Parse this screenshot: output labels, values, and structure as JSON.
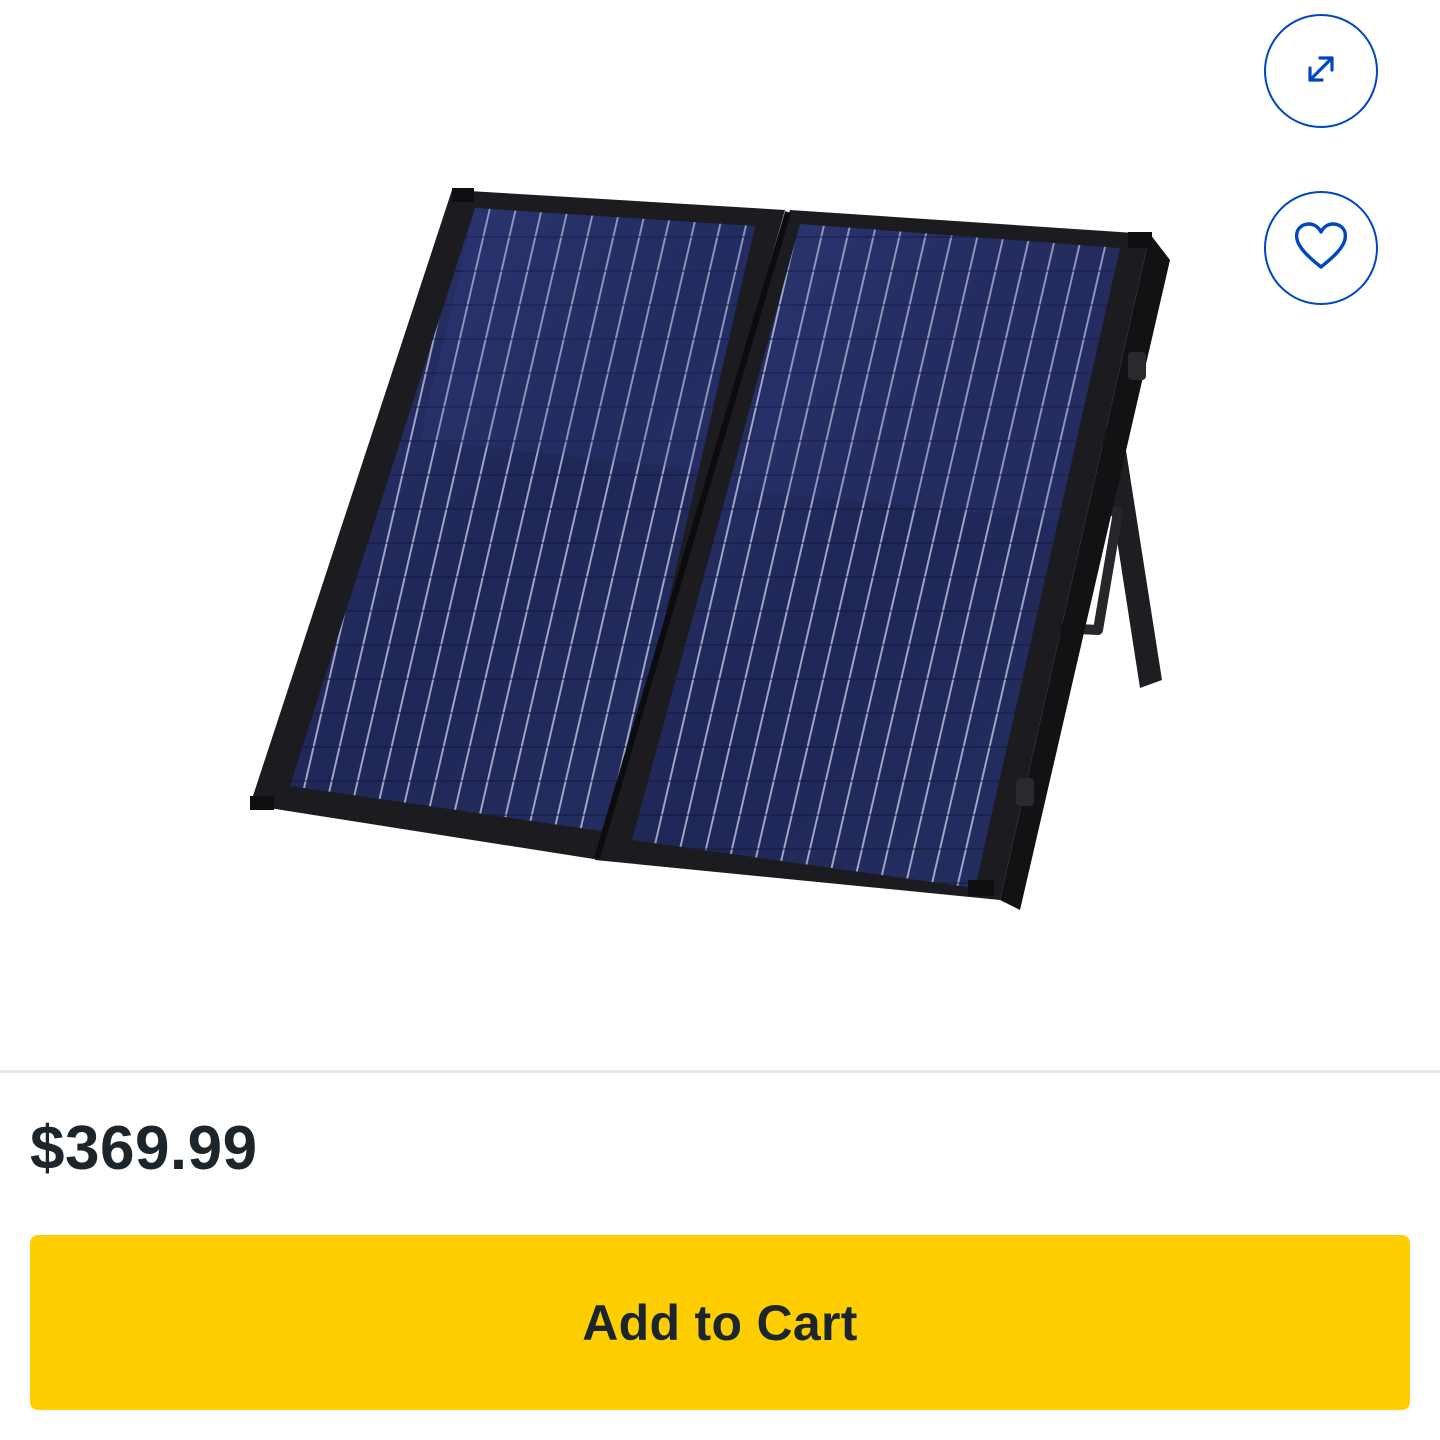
{
  "product": {
    "image_alt": "Portable folding solar panel kit",
    "price": "$369.99"
  },
  "actions": {
    "expand_icon": "expand-arrows-icon",
    "wishlist_icon": "heart-icon",
    "add_to_cart_label": "Add to Cart"
  },
  "colors": {
    "accent_blue": "#0046be",
    "cart_yellow": "#ffce00",
    "text_dark": "#1d252c"
  }
}
